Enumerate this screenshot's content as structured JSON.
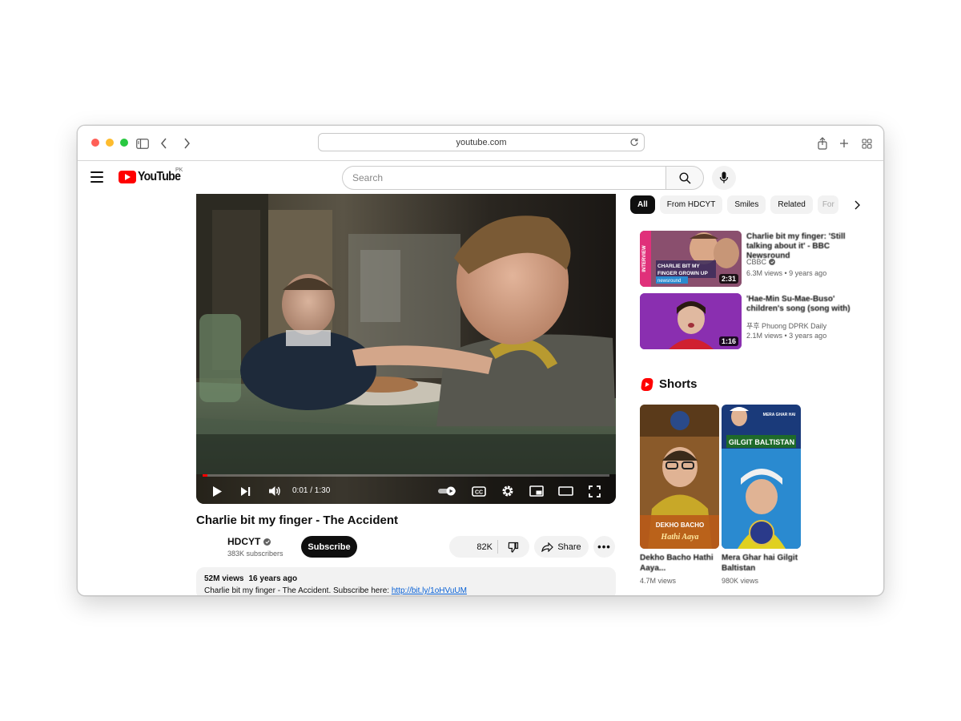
{
  "browser": {
    "url": "youtube.com",
    "traffic_lights": [
      "#ff5f57",
      "#febc2e",
      "#28c840"
    ]
  },
  "header": {
    "logo_text": "YouTube",
    "region": "PK",
    "search_placeholder": "Search"
  },
  "player": {
    "current_time": "0:01",
    "duration": "1:30",
    "time_display": "0:01 / 1:30",
    "progress_fraction": 0.011
  },
  "video": {
    "title": "Charlie bit my finger - The Accident",
    "channel": "HDCYT",
    "subscribers": "383K subscribers",
    "subscribe_label": "Subscribe",
    "likes": "82K",
    "share_label": "Share",
    "more_label": "•••",
    "views": "52M views",
    "age": "16 years ago",
    "description": "Charlie bit my finger - The Accident. Subscribe here: ",
    "description_link": "http://bit.ly/1oHVuUM"
  },
  "chips": [
    "All",
    "From HDCYT",
    "Smiles",
    "Related",
    "For"
  ],
  "recommendations": [
    {
      "title": "Charlie bit my finger: 'Still talking about it' - BBC Newsround",
      "channel": "CBBC",
      "verified": true,
      "stats": "6.3M views • 9 years ago",
      "duration": "2:31",
      "thumb_caption": "CHARLIE BIT MY FINGER GROWN UP",
      "thumb_badge": "INTERVIEW",
      "thumb_brand": "newsround"
    },
    {
      "title": "'Hae-Min Su-Mae-Buso' children's song (song with)",
      "channel": "푸후 Phuong DPRK Daily",
      "verified": false,
      "stats": "2.1M views • 3 years ago",
      "duration": "1:16"
    }
  ],
  "shorts": {
    "heading": "Shorts",
    "items": [
      {
        "title": "Dekho Bacho Hathi Aaya...",
        "views": "4.7M views",
        "caption_top": "DEKHO BACHO",
        "caption_bottom": "Hathi Aaya"
      },
      {
        "title": "Mera Ghar hai Gilgit Baltistan",
        "views": "980K views",
        "caption_small": "MERA GHAR HAI",
        "caption_top": "GILGIT BALTISTAN"
      }
    ]
  }
}
